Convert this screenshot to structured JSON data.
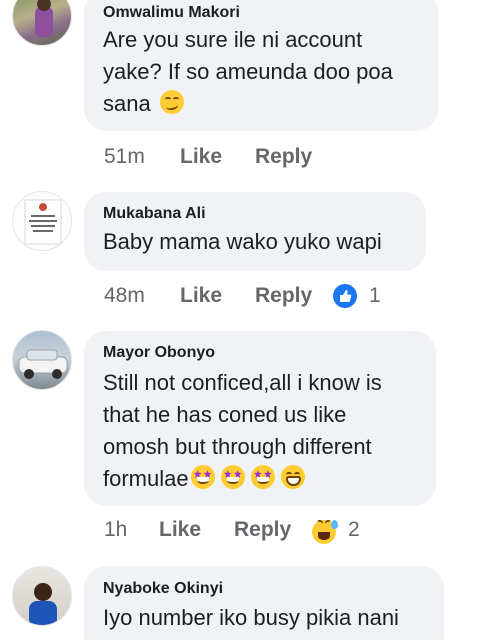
{
  "comments": [
    {
      "author": "Omwalimu Makori",
      "lines": [
        "Are you sure ile ni account",
        "yake? If so ameunda doo poa",
        "sana"
      ],
      "emoji": [
        "smirk-face"
      ],
      "time": "51m",
      "like_label": "Like",
      "reply_label": "Reply"
    },
    {
      "author": "Mukabana Ali",
      "lines": [
        "Baby mama wako yuko wapi"
      ],
      "time": "48m",
      "like_label": "Like",
      "reply_label": "Reply",
      "reaction": {
        "icon": "like-reaction-icon",
        "count": "1",
        "color": "#1877f2"
      }
    },
    {
      "author": "Mayor Obonyo",
      "lines": [
        "Still not conficed,all i know is",
        "that he has coned us like",
        "omosh but through different",
        "formulae"
      ],
      "emoji": [
        "star-struck-face",
        "star-struck-face",
        "star-struck-face",
        "grimacing-face"
      ],
      "time": "1h",
      "like_label": "Like",
      "reply_label": "Reply",
      "reaction": {
        "icon": "haha-reaction-icon",
        "count": "2",
        "color": "#f7b125"
      }
    },
    {
      "author": "Nyaboke Okinyi",
      "lines": [
        "Iyo number iko busy pikia nani"
      ],
      "time": "",
      "like_label": "",
      "reply_label": ""
    }
  ]
}
